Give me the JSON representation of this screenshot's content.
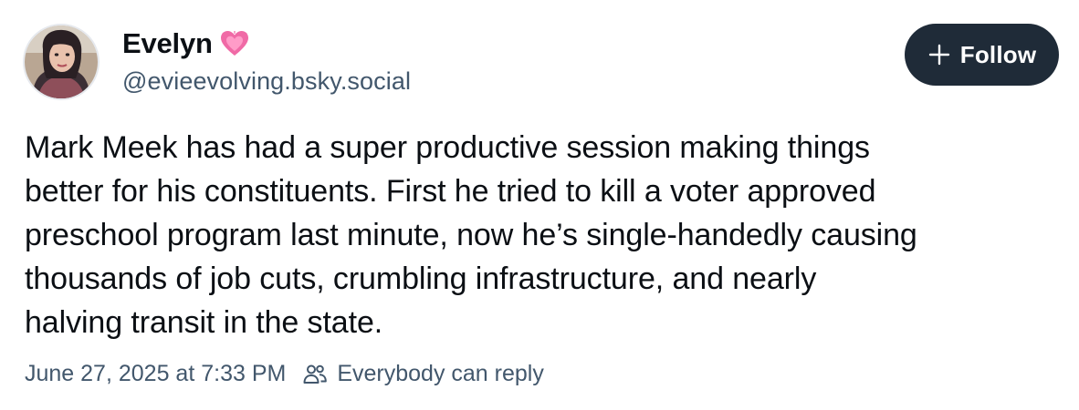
{
  "author": {
    "display_name": "Evelyn",
    "handle": "@evieevolving.bsky.social",
    "badge_icon": "pink-heart-icon",
    "avatar_icon": "profile-photo"
  },
  "follow_button": {
    "label": "Follow",
    "icon": "plus-icon"
  },
  "post": {
    "text": "Mark Meek has had a super productive session making things\nbetter for his constituents. First he tried to kill a voter approved\npreschool program last minute, now he’s single-handedly causing\nthousands of job cuts, crumbling infrastructure, and nearly\nhalving transit in the state.",
    "timestamp": "June 27, 2025 at 7:33 PM",
    "reply_setting": "Everybody can reply",
    "reply_icon": "people-icon"
  },
  "colors": {
    "text": "#0b0f14",
    "muted": "#42576c",
    "button_bg": "#1f2b38",
    "heart": "#f06aa6"
  }
}
